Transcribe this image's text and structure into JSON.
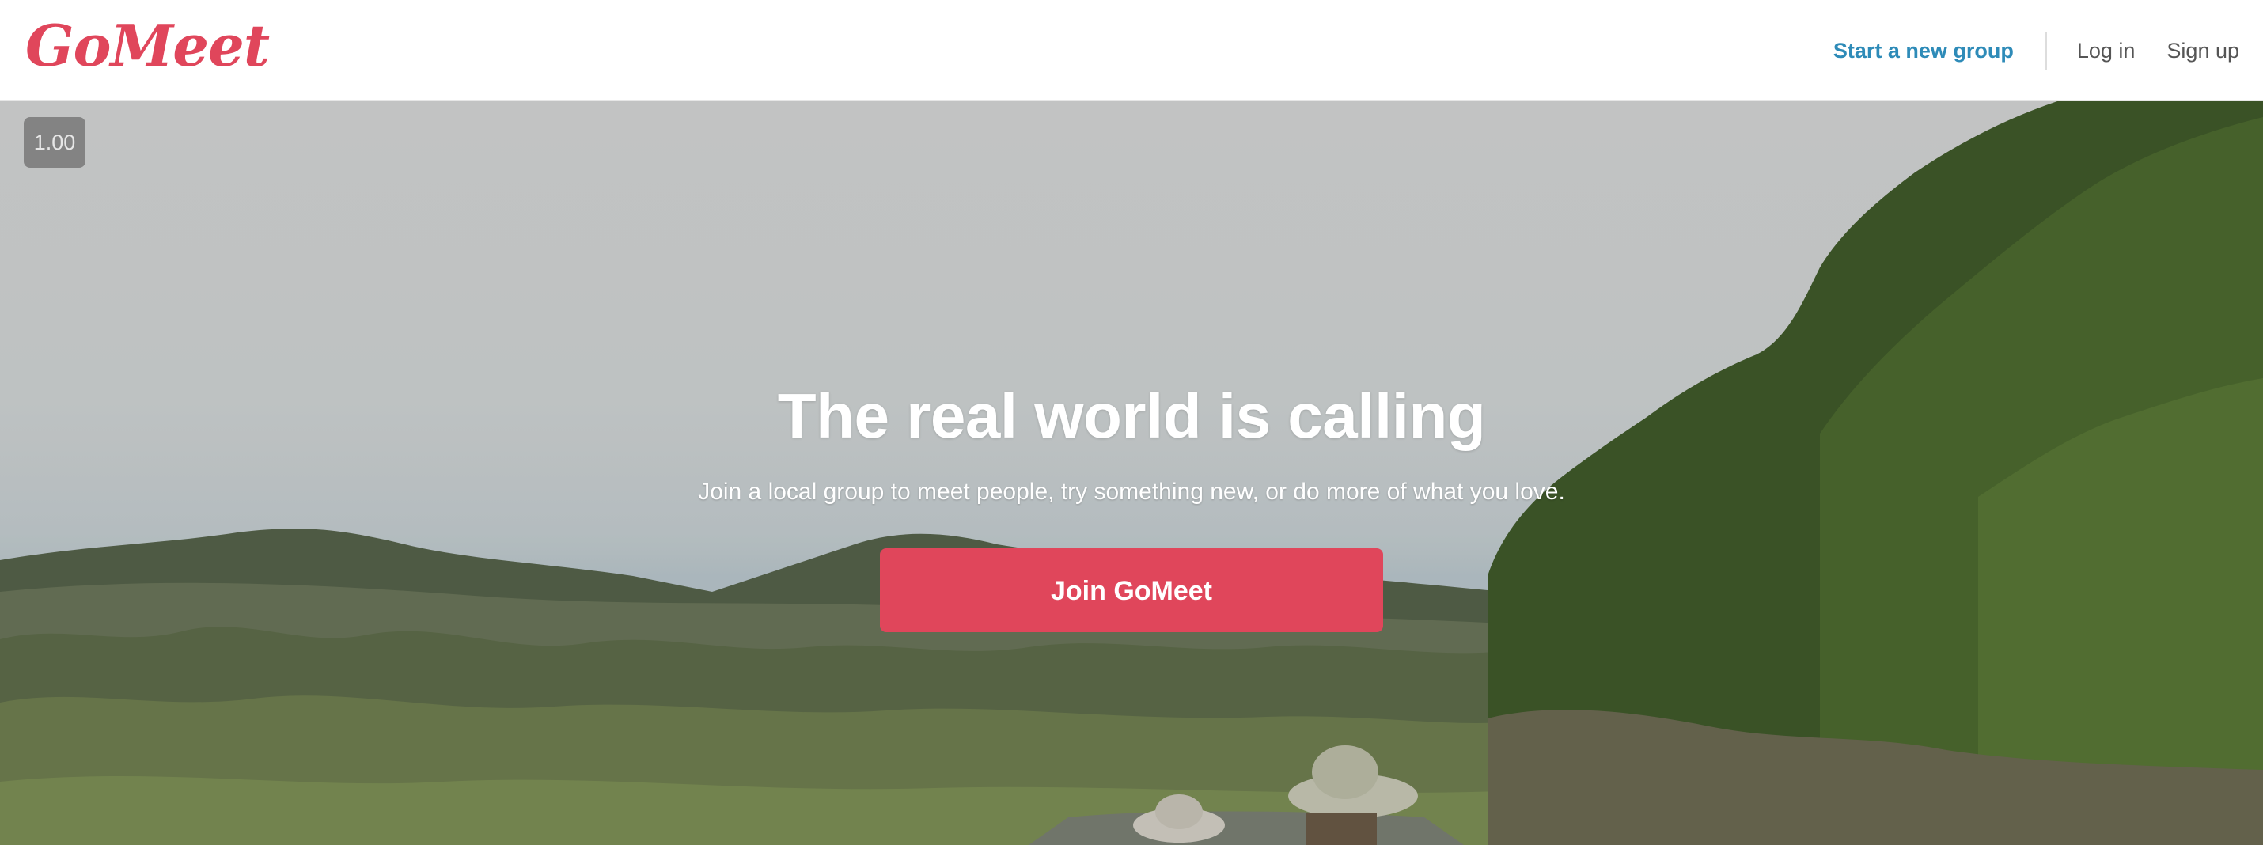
{
  "header": {
    "logo_text": "GoMeet",
    "nav": {
      "start_group_label": "Start a new group",
      "login_label": "Log in",
      "signup_label": "Sign up"
    },
    "colors": {
      "brand": "#e0465b",
      "link_primary": "#2e8bb8"
    }
  },
  "hero": {
    "speed_badge": "1.00",
    "title": "The real world is calling",
    "subtitle": "Join a local group to meet people, try something new, or do more of what you love.",
    "cta_label": "Join GoMeet",
    "colors": {
      "cta": "#e0465b"
    }
  }
}
